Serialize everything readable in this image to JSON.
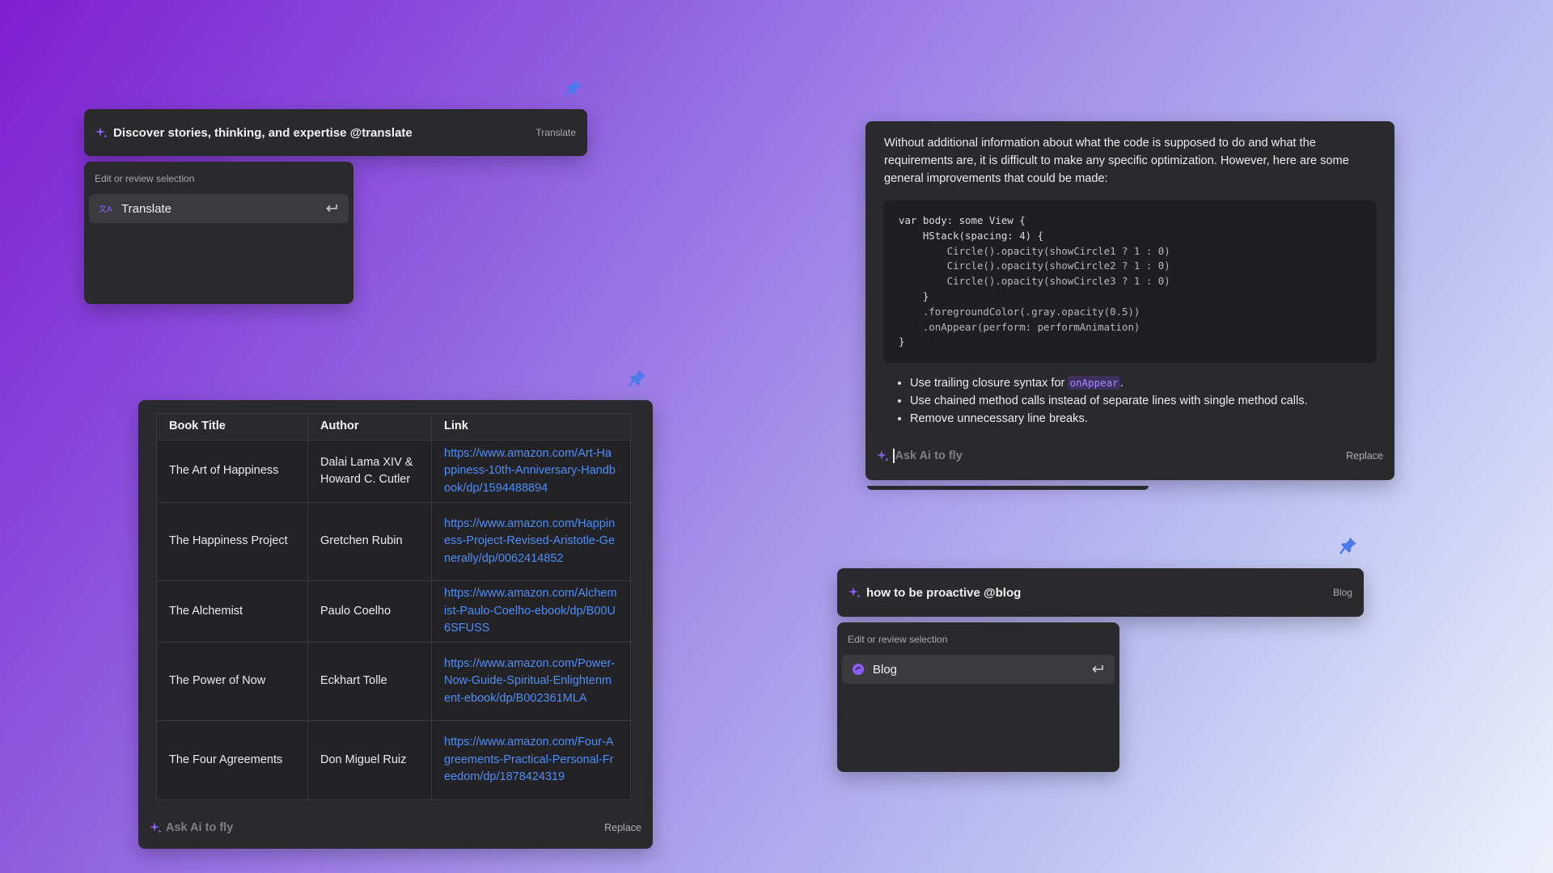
{
  "colors": {
    "accent": "#8b5cf6",
    "link": "#4f8df8",
    "panel": "#2a2a2c",
    "pin": "#4a7be8"
  },
  "translate_widget": {
    "prompt": "Discover stories, thinking, and expertise @translate",
    "tag": "Translate",
    "menu_hint": "Edit or review selection",
    "menu_item": "Translate"
  },
  "table_widget": {
    "headers": [
      "Book Title",
      "Author",
      "Link"
    ],
    "rows": [
      {
        "title": "The Art of Happiness",
        "author": "Dalai Lama XIV & Howard C. Cutler",
        "link": "https://www.amazon.com/Art-Happiness-10th-Anniversary-Handbook/dp/1594488894"
      },
      {
        "title": "The Happiness Project",
        "author": "Gretchen Rubin",
        "link": "https://www.amazon.com/Happiness-Project-Revised-Aristotle-Generally/dp/0062414852"
      },
      {
        "title": "The Alchemist",
        "author": "Paulo Coelho",
        "link": "https://www.amazon.com/Alchemist-Paulo-Coelho-ebook/dp/B00U6SFUSS"
      },
      {
        "title": "The Power of Now",
        "author": "Eckhart Tolle",
        "link": "https://www.amazon.com/Power-Now-Guide-Spiritual-Enlightenment-ebook/dp/B002361MLA"
      },
      {
        "title": "The Four Agreements",
        "author": "Don Miguel Ruiz",
        "link": "https://www.amazon.com/Four-Agreements-Practical-Personal-Freedom/dp/1878424319"
      }
    ],
    "ask_placeholder": "Ask Ai to fly",
    "replace": "Replace"
  },
  "code_widget": {
    "intro": "Without additional information about what the code is supposed to do and what the requirements are, it is difficult to make any specific optimization. However, here are some general improvements that could be made:",
    "code_lines": [
      "var body: some View {",
      "    HStack(spacing: 4) {",
      "        Circle().opacity(showCircle1 ? 1 : 0)",
      "        Circle().opacity(showCircle2 ? 1 : 0)",
      "        Circle().opacity(showCircle3 ? 1 : 0)",
      "    }",
      "    .foregroundColor(.gray.opacity(0.5))",
      "    .onAppear(perform: performAnimation)",
      "}"
    ],
    "bullets": [
      {
        "before": "Use trailing closure syntax for ",
        "code": "onAppear",
        "after": "."
      },
      {
        "before": "Use chained method calls instead of separate lines with single method calls.",
        "code": "",
        "after": ""
      },
      {
        "before": "Remove unnecessary line breaks.",
        "code": "",
        "after": ""
      }
    ],
    "ask_placeholder": "Ask Ai to fly",
    "replace": "Replace"
  },
  "blog_widget": {
    "prompt": "how to be proactive @blog",
    "tag": "Blog",
    "menu_hint": "Edit or review selection",
    "menu_item": "Blog"
  }
}
